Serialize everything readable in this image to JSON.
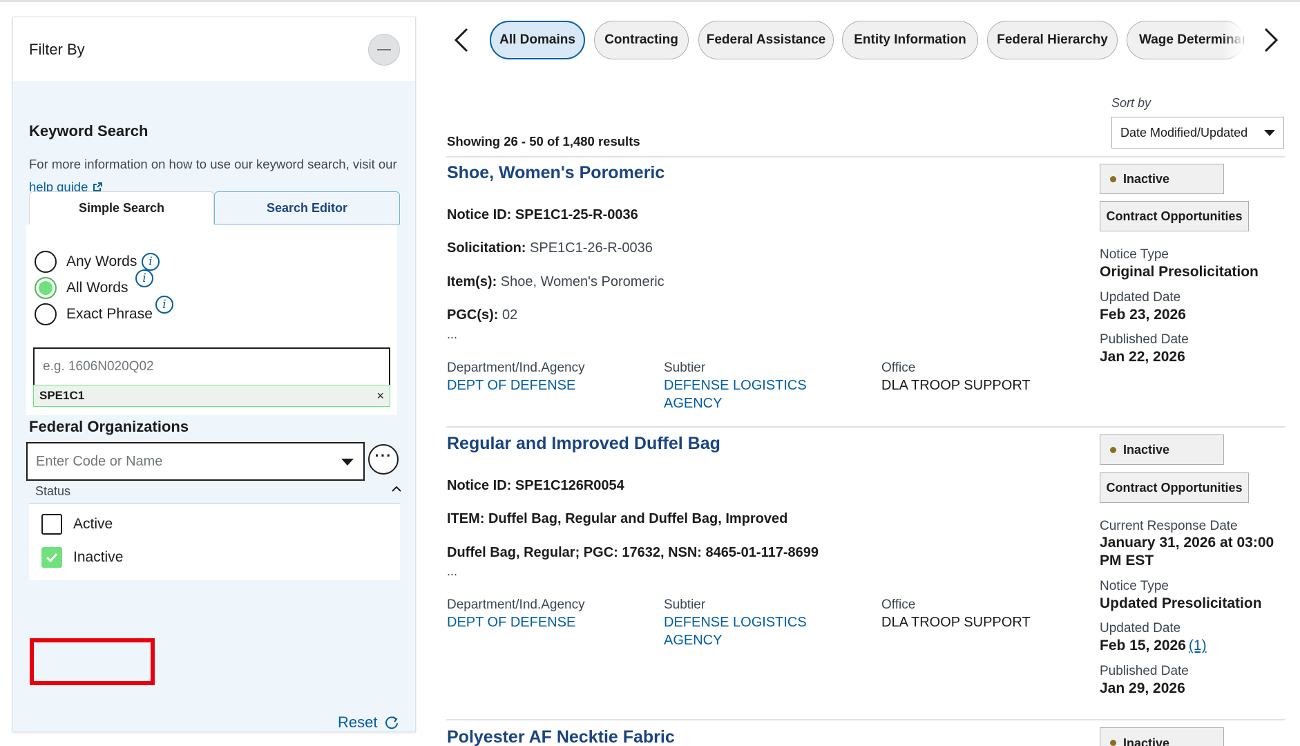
{
  "filter": {
    "title": "Filter By",
    "keyword_search": {
      "title": "Keyword Search",
      "help_text": "For more information on how to use our keyword search, visit our",
      "help_link": "help guide",
      "tabs": [
        "Simple Search",
        "Search Editor"
      ],
      "options": [
        {
          "label": "Any Words",
          "checked": false
        },
        {
          "label": "All Words",
          "checked": true
        },
        {
          "label": "Exact Phrase",
          "checked": false
        }
      ],
      "input_placeholder": "e.g. 1606N020Q02",
      "chip": "SPE1C1",
      "chip_close": "×"
    },
    "federal_orgs": {
      "title": "Federal Organizations",
      "placeholder": "Enter Code or Name",
      "more": "···"
    },
    "status": {
      "label": "Status",
      "options": [
        {
          "label": "Active",
          "checked": false
        },
        {
          "label": "Inactive",
          "checked": true
        }
      ]
    },
    "reset": "Reset"
  },
  "domains": [
    "All Domains",
    "Contracting",
    "Federal Assistance",
    "Entity Information",
    "Federal Hierarchy",
    "Wage Determinat"
  ],
  "sort": {
    "label": "Sort by",
    "value": "Date Modified/Updated"
  },
  "results_count": "Showing 26 - 50 of 1,480 results",
  "results": [
    {
      "title": "Shoe, Women's Poromeric",
      "notice_id": "Notice ID: SPE1C1-25-R-0036",
      "solicitation_label": "Solicitation:",
      "solicitation_value": " SPE1C1-26-R-0036",
      "items_label": "Item(s):",
      "items_value": " Shoe, Women's Poromeric",
      "pgc_label": "PGC(s):",
      "pgc_value": " 02",
      "ellipsis": "...",
      "department_label": "Department/Ind.Agency",
      "department": "DEPT OF DEFENSE",
      "subtier_label": "Subtier",
      "subtier": "DEFENSE LOGISTICS AGENCY",
      "office_label": "Office",
      "office": "DLA TROOP SUPPORT",
      "status": "Inactive",
      "type": "Contract Opportunities",
      "notice_type_label": "Notice Type",
      "notice_type": "Original Presolicitation",
      "updated_label": "Updated Date",
      "updated": "Feb 23, 2026",
      "published_label": "Published Date",
      "published": "Jan 22, 2026"
    },
    {
      "title": "Regular and Improved Duffel Bag",
      "notice_id": "Notice ID: SPE1C126R0054",
      "line2": "ITEM: Duffel Bag, Regular and Duffel Bag, Improved",
      "line3": "Duffel Bag, Regular; PGC: 17632, NSN: 8465-01-117-8699",
      "ellipsis": "...",
      "department_label": "Department/Ind.Agency",
      "department": "DEPT OF DEFENSE",
      "subtier_label": "Subtier",
      "subtier": "DEFENSE LOGISTICS AGENCY",
      "office_label": "Office",
      "office": "DLA TROOP SUPPORT",
      "status": "Inactive",
      "type": "Contract Opportunities",
      "response_label": "Current Response Date",
      "response": "January 31, 2026 at 03:00 PM EST",
      "notice_type_label": "Notice Type",
      "notice_type": "Updated Presolicitation",
      "updated_label": "Updated Date",
      "updated": "Feb 15, 2026",
      "updated_link": "(1)",
      "published_label": "Published Date",
      "published": "Jan 29, 2026"
    },
    {
      "title": "Polyester AF Necktie Fabric",
      "status": "Inactive"
    }
  ]
}
